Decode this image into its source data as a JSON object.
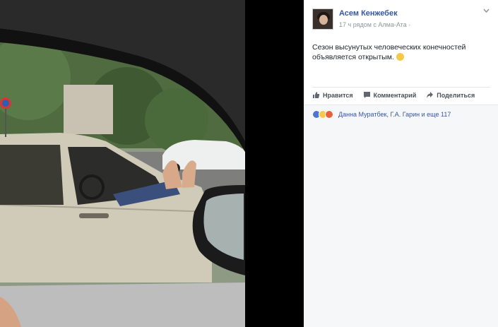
{
  "post": {
    "author": "Асем Кенжебек",
    "meta": "17 ч рядом с Алма-Ата ·",
    "text": "Сезон высунутых человеческих конечностей объявляется открытым.",
    "options_icon": "chevron-down-icon"
  },
  "actions": {
    "like": "Нравится",
    "comment": "Комментарий",
    "share": "Поделиться"
  },
  "reactions": {
    "summary": "Данна Муратбек, Г.А. Гарин и еще 117",
    "icons": [
      "like-reaction-icon",
      "haha-reaction-icon",
      "angry-reaction-icon"
    ]
  },
  "colors": {
    "link": "#365899",
    "meta": "#90949c",
    "like": "#4a76d4"
  }
}
